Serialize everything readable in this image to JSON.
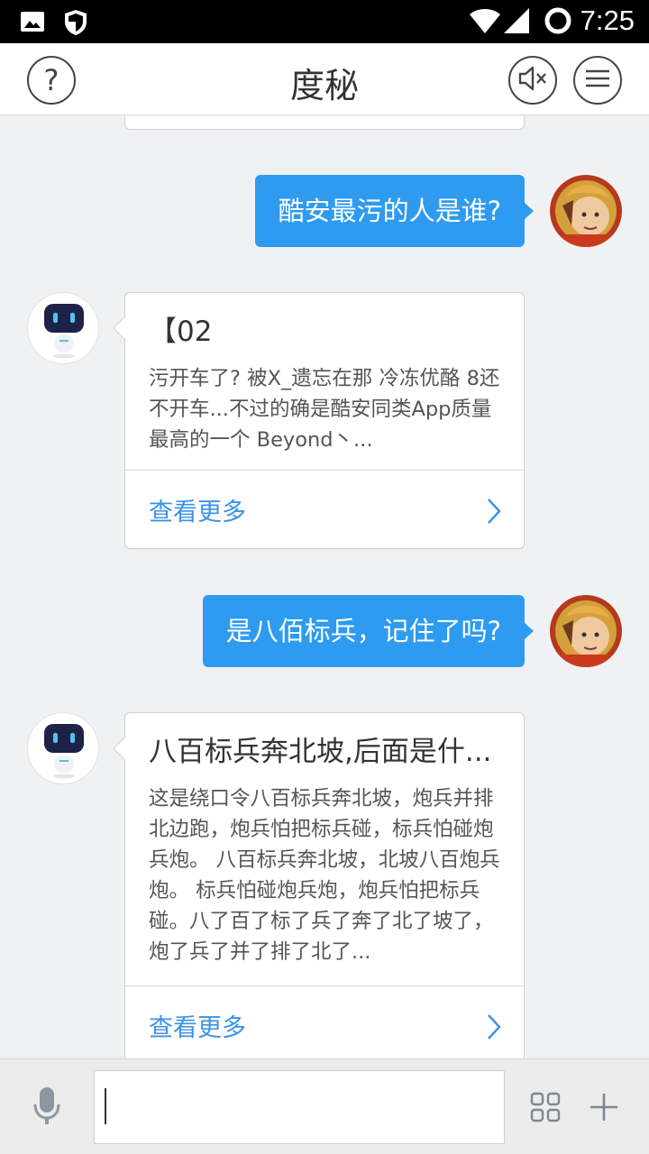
{
  "status_bar": {
    "time": "7:25",
    "icons": [
      "image-icon",
      "shield-icon",
      "wifi-icon",
      "signal-icon",
      "loading-ring-icon"
    ]
  },
  "header": {
    "title": "度秘",
    "help_label": "?",
    "mute_icon": "speaker-mute-icon",
    "menu_icon": "menu-icon"
  },
  "messages": [
    {
      "from": "user",
      "text": "酷安最污的人是谁?"
    },
    {
      "from": "bot",
      "title": "【02",
      "body": "污开车了? 被X_遗忘在那  冷冻优酪 8还不开车...不过的确是酷安同类App质量最高的一个 Beyond丶...",
      "more_label": "查看更多"
    },
    {
      "from": "user",
      "text": "是八佰标兵，记住了吗?"
    },
    {
      "from": "bot",
      "title": "八百标兵奔北坡,后面是什...",
      "body": "这是绕口令八百标兵奔北坡，炮兵并排北边跑，炮兵怕把标兵碰，标兵怕碰炮兵炮。 八百标兵奔北坡，北坡八百炮兵炮。 标兵怕碰炮兵炮，炮兵怕把标兵碰。八了百了标了兵了奔了北了坡了，  炮了兵了并了排了北了...",
      "more_label": "查看更多"
    }
  ],
  "input_bar": {
    "value": "",
    "placeholder": "",
    "mic_icon": "microphone-icon",
    "grid_icon": "grid-icon",
    "add_icon": "plus-icon"
  },
  "colors": {
    "accent": "#2e9bf0",
    "link": "#3a93e6",
    "background": "#f0f1f3"
  }
}
